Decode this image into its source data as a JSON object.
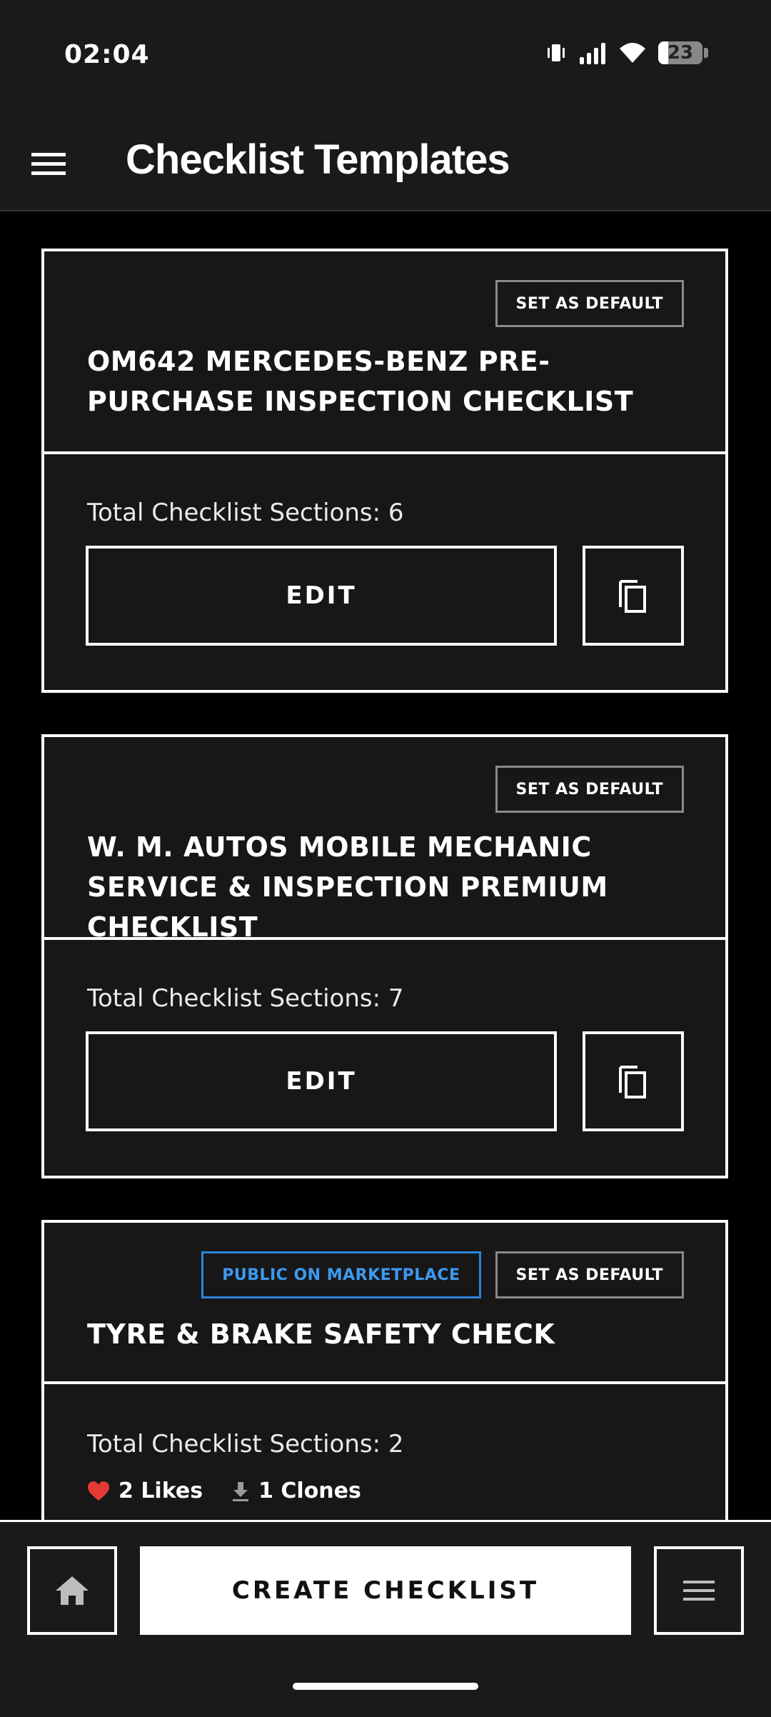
{
  "status": {
    "time": "02:04",
    "battery": "23"
  },
  "header": {
    "title": "Checklist Templates"
  },
  "cards": [
    {
      "title": "OM642 MERCEDES-BENZ PRE-PURCHASE INSPECTION CHECKLIST",
      "set_default_label": "SET AS DEFAULT",
      "sections": "Total Checklist Sections: 6",
      "edit_label": "EDIT"
    },
    {
      "title": "W. M. AUTOS MOBILE MECHANIC SERVICE & INSPECTION PREMIUM CHECKLIST",
      "set_default_label": "SET AS DEFAULT",
      "sections": "Total Checklist Sections: 7",
      "edit_label": "EDIT"
    },
    {
      "title": "TYRE & BRAKE SAFETY CHECK",
      "public_label": "PUBLIC ON MARKETPLACE",
      "set_default_label": "SET AS DEFAULT",
      "sections": "Total Checklist Sections: 2",
      "likes": "2 Likes",
      "clones": "1 Clones"
    }
  ],
  "bottom": {
    "create_label": "CREATE CHECKLIST"
  },
  "icons": {
    "menu": "hamburger-menu-icon",
    "copy": "copy-icon",
    "heart": "heart-icon",
    "download": "download-icon",
    "home": "home-icon",
    "more": "menu-icon"
  },
  "colors": {
    "accent_blue": "#3b9af0",
    "heart_red": "#e53935"
  }
}
